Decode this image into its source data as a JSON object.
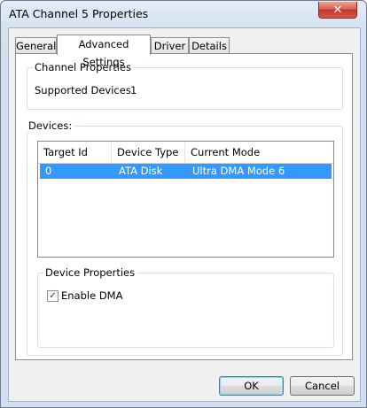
{
  "window": {
    "title": "ATA Channel 5 Properties"
  },
  "tabs": [
    {
      "label": "General"
    },
    {
      "label": "Advanced Settings"
    },
    {
      "label": "Driver"
    },
    {
      "label": "Details"
    }
  ],
  "channel_properties": {
    "label": "Channel Properties",
    "supported_devices_label": "Supported Devices",
    "supported_devices_value": "1"
  },
  "devices": {
    "label": "Devices:",
    "columns": [
      "Target Id",
      "Device Type",
      "Current Mode"
    ],
    "rows": [
      {
        "target_id": "0",
        "device_type": "ATA Disk",
        "current_mode": "Ultra DMA Mode 6"
      }
    ]
  },
  "device_properties": {
    "label": "Device Properties",
    "enable_dma_label": "Enable DMA",
    "enable_dma_checked": true,
    "check_mark": "✓"
  },
  "buttons": {
    "ok": "OK",
    "cancel": "Cancel"
  },
  "icons": {
    "close": "✕"
  }
}
